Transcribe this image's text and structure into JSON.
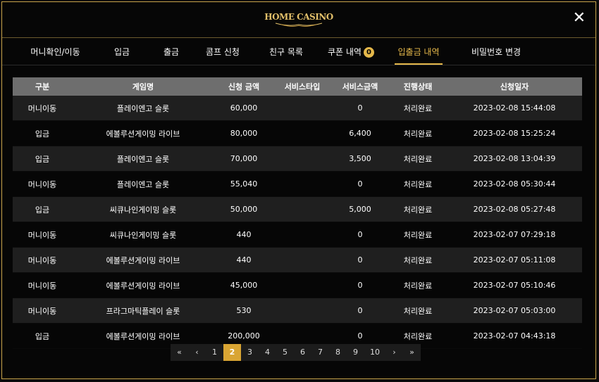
{
  "header": {
    "logo_text": "HOME CASINO",
    "close_glyph": "✕"
  },
  "tabs": [
    {
      "label": "머니확인/이동"
    },
    {
      "label": "입금"
    },
    {
      "label": "출금"
    },
    {
      "label": "콤프 신청"
    },
    {
      "label": "친구 목록"
    },
    {
      "label": "쿠폰 내역",
      "badge": "0"
    },
    {
      "label": "입출금 내역",
      "active": true
    },
    {
      "label": "비밀번호 변경"
    }
  ],
  "table": {
    "columns": [
      "구분",
      "게임명",
      "신청 금액",
      "서비스타입",
      "서비스금액",
      "진행상태",
      "신청일자"
    ],
    "rows": [
      [
        "머니이동",
        "플레이엔고 슬롯",
        "60,000",
        "",
        "0",
        "처리완료",
        "2023-02-08 15:44:08"
      ],
      [
        "입금",
        "에볼루션게이밍 라이브",
        "80,000",
        "",
        "6,400",
        "처리완료",
        "2023-02-08 15:25:24"
      ],
      [
        "입금",
        "플레이엔고 슬롯",
        "70,000",
        "",
        "3,500",
        "처리완료",
        "2023-02-08 13:04:39"
      ],
      [
        "머니이동",
        "플레이엔고 슬롯",
        "55,040",
        "",
        "0",
        "처리완료",
        "2023-02-08 05:30:44"
      ],
      [
        "입금",
        "씨큐나인게이밍 슬롯",
        "50,000",
        "",
        "5,000",
        "처리완료",
        "2023-02-08 05:27:48"
      ],
      [
        "머니이동",
        "씨큐나인게이밍 슬롯",
        "440",
        "",
        "0",
        "처리완료",
        "2023-02-07 07:29:18"
      ],
      [
        "머니이동",
        "에볼루션게이밍 라이브",
        "440",
        "",
        "0",
        "처리완료",
        "2023-02-07 05:11:08"
      ],
      [
        "머니이동",
        "에볼루션게이밍 라이브",
        "45,000",
        "",
        "0",
        "처리완료",
        "2023-02-07 05:10:46"
      ],
      [
        "머니이동",
        "프라그마틱플레이 슬롯",
        "530",
        "",
        "0",
        "처리완료",
        "2023-02-07 05:03:00"
      ],
      [
        "입금",
        "에볼루션게이밍 라이브",
        "200,000",
        "",
        "0",
        "처리완료",
        "2023-02-07 04:43:18"
      ]
    ]
  },
  "pagination": {
    "items": [
      "«",
      "‹",
      "1",
      "2",
      "3",
      "4",
      "5",
      "6",
      "7",
      "8",
      "9",
      "10",
      "›",
      "»"
    ],
    "active": "2"
  },
  "colors": {
    "accent": "#e5b84a",
    "header_bg": "#6e6e6e",
    "active_page": "#d9a533"
  }
}
